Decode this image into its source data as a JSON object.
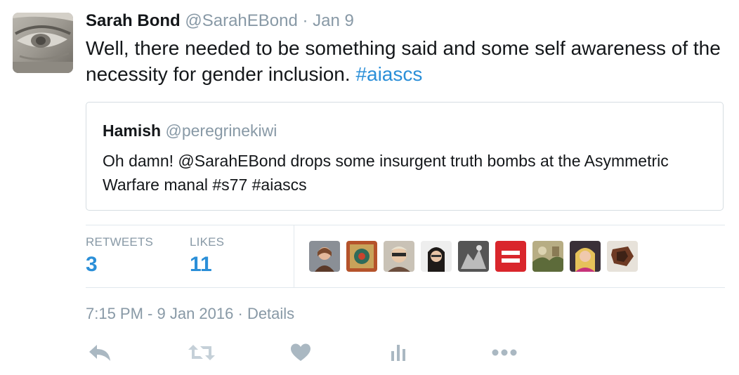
{
  "tweet": {
    "author_name": "Sarah Bond",
    "author_handle": "@SarahEBond",
    "separator": "·",
    "date": "Jan 9",
    "text_main": "Well, there needed to be something said and some self awareness of the necessity for gender inclusion. ",
    "hashtag": "#aiascs"
  },
  "quote": {
    "author_name": "Hamish",
    "author_handle": "@peregrinekiwi",
    "text": "Oh damn! @SarahEBond drops some insurgent truth bombs at the Asymmetric Warfare manal #s77 #aiascs"
  },
  "stats": {
    "retweets_label": "RETWEETS",
    "retweets_count": "3",
    "likes_label": "LIKES",
    "likes_count": "11"
  },
  "likers": [
    {
      "icon": "liker-avatar"
    },
    {
      "icon": "liker-avatar"
    },
    {
      "icon": "liker-avatar"
    },
    {
      "icon": "liker-avatar"
    },
    {
      "icon": "liker-avatar"
    },
    {
      "icon": "equality-logo-avatar"
    },
    {
      "icon": "liker-avatar"
    },
    {
      "icon": "liker-avatar"
    },
    {
      "icon": "liker-avatar"
    }
  ],
  "footer": {
    "timestamp": "7:15 PM - 9 Jan 2016",
    "separator": "·",
    "details_link": "Details"
  },
  "colors": {
    "link": "#2b8fd8",
    "muted": "#8899a6",
    "text": "#14171a",
    "border": "#e1e8ed",
    "action_icon": "#aab8c2",
    "equality_red": "#d9262c"
  },
  "actions": [
    {
      "icon": "reply-icon"
    },
    {
      "icon": "retweet-icon"
    },
    {
      "icon": "like-heart-icon"
    },
    {
      "icon": "analytics-icon"
    },
    {
      "icon": "more-icon"
    }
  ]
}
